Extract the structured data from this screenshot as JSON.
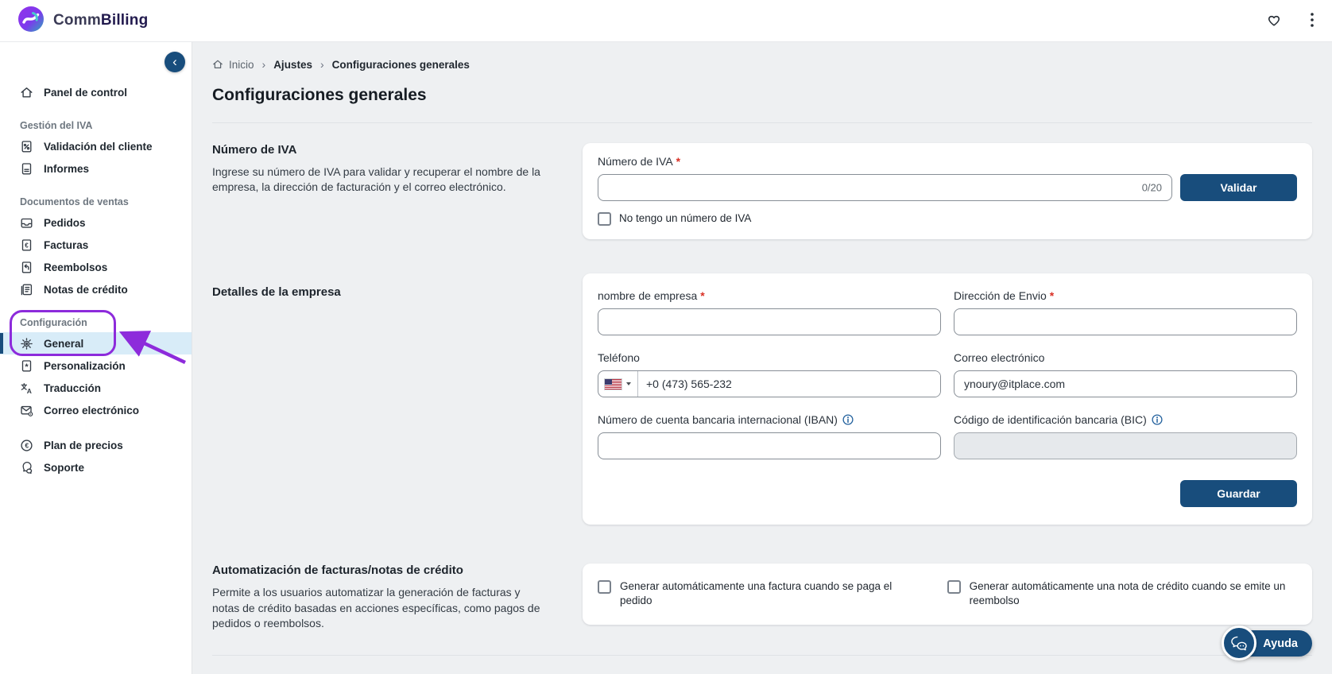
{
  "colors": {
    "primary": "#184d7c",
    "active_item_bg": "#d8ecf8",
    "annotation_purple": "#8d2bdb",
    "required_red": "#d93025",
    "info_blue": "#24629e",
    "page_bg": "#eef0f2",
    "brand_purple": "#7c3aed",
    "brand_teal": "#2caabb"
  },
  "header": {
    "brand_regular": "Comm",
    "brand_bold": "Billing",
    "icons": [
      "heart-icon",
      "kebab-menu-icon"
    ]
  },
  "sidebar": {
    "collapse_icon": "‹",
    "dashboard": {
      "label": "Panel de control",
      "icon": "home-icon"
    },
    "groups": [
      {
        "title": "Gestión del IVA",
        "items": [
          {
            "label": "Validación del cliente",
            "icon": "document-percent-icon"
          },
          {
            "label": "Informes",
            "icon": "report-icon"
          }
        ]
      },
      {
        "title": "Documentos de ventas",
        "items": [
          {
            "label": "Pedidos",
            "icon": "inbox-icon"
          },
          {
            "label": "Facturas",
            "icon": "invoice-euro-icon"
          },
          {
            "label": "Reembolsos",
            "icon": "refund-icon"
          },
          {
            "label": "Notas de crédito",
            "icon": "credit-note-icon"
          }
        ]
      },
      {
        "title": "Configuración",
        "items": [
          {
            "label": "General",
            "icon": "gear-icon",
            "active": true
          },
          {
            "label": "Personalización",
            "icon": "customize-icon"
          },
          {
            "label": "Traducción",
            "icon": "translate-icon"
          },
          {
            "label": "Correo electrónico",
            "icon": "mail-gear-icon"
          }
        ]
      },
      {
        "title": "",
        "items": [
          {
            "label": "Plan de precios",
            "icon": "euro-circle-icon"
          },
          {
            "label": "Soporte",
            "icon": "support-chat-icon"
          }
        ]
      }
    ]
  },
  "breadcrumb": {
    "home": "Inicio",
    "separator": "›",
    "level1": "Ajustes",
    "level2": "Configuraciones generales"
  },
  "page": {
    "title": "Configuraciones generales"
  },
  "shared": {
    "required_mark": "*"
  },
  "vat_section": {
    "heading": "Número de IVA",
    "description": "Ingrese su número de IVA para validar y recuperar el nombre de la empresa, la dirección de facturación y el correo electrónico.",
    "field_label": "Número de IVA",
    "input_value": "",
    "char_counter": "0/20",
    "validate_button": "Validar",
    "checkbox_label": "No tengo un número de IVA",
    "checkbox_checked": false
  },
  "company_section": {
    "heading": "Detalles de la empresa",
    "company_name_label": "nombre de empresa",
    "company_name_value": "",
    "shipping_address_label": "Dirección de Envio",
    "shipping_address_value": "",
    "phone_label": "Teléfono",
    "phone_country": "us-flag-icon",
    "phone_value": "+0 (473) 565-232",
    "email_label": "Correo electrónico",
    "email_value": "ynoury@itplace.com",
    "iban_label": "Número de cuenta bancaria internacional (IBAN)",
    "iban_value": "",
    "bic_label": "Código de identificación bancaria (BIC)",
    "bic_value": "",
    "bic_disabled": true,
    "save_button": "Guardar"
  },
  "automation_section": {
    "heading": "Automatización de facturas/notas de crédito",
    "description": "Permite a los usuarios automatizar la generación de facturas y notas de crédito basadas en acciones específicas, como pagos de pedidos o reembolsos.",
    "checkbox_invoice_label": "Generar automáticamente una factura cuando se paga el pedido",
    "checkbox_invoice_checked": false,
    "checkbox_credit_note_label": "Generar automáticamente una nota de crédito cuando se emite un reembolso",
    "checkbox_credit_note_checked": false
  },
  "help": {
    "label": "Ayuda"
  }
}
